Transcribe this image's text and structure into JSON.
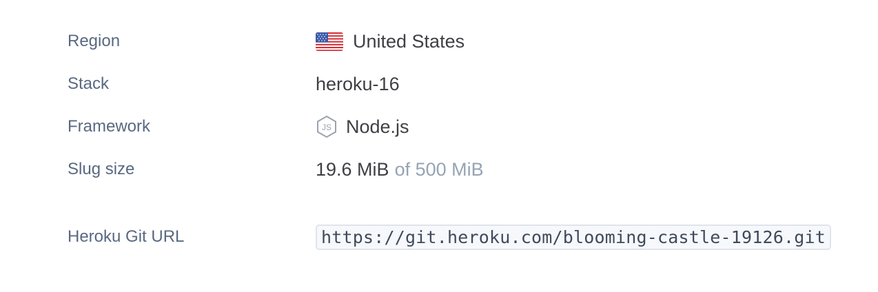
{
  "app_info": {
    "region": {
      "label": "Region",
      "value": "United States",
      "icon": "us-flag-icon"
    },
    "stack": {
      "label": "Stack",
      "value": "heroku-16"
    },
    "framework": {
      "label": "Framework",
      "value": "Node.js",
      "icon": "nodejs-icon"
    },
    "slug_size": {
      "label": "Slug size",
      "value": "19.6 MiB",
      "limit": "of 500 MiB"
    },
    "git_url": {
      "label": "Heroku Git URL",
      "value": "https://git.heroku.com/blooming-castle-19126.git"
    }
  },
  "colors": {
    "label_text": "#596981",
    "value_text": "#3f3f44",
    "muted_text": "#96a3b6",
    "code_bg": "#f6f8fb",
    "code_border": "#dfe4ec"
  }
}
